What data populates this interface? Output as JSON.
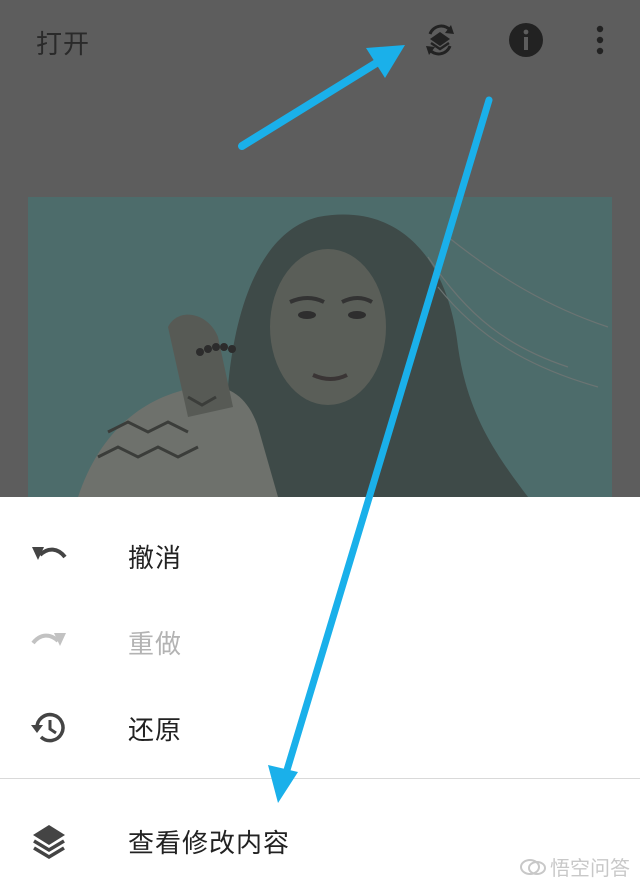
{
  "topbar": {
    "open_label": "打开",
    "icons": [
      "revert-layers-icon",
      "info-icon",
      "more-vert-icon"
    ]
  },
  "sheet": {
    "items": [
      {
        "label": "撤消",
        "icon": "undo-icon",
        "enabled": true
      },
      {
        "label": "重做",
        "icon": "redo-icon",
        "enabled": false
      },
      {
        "label": "还原",
        "icon": "history-icon",
        "enabled": true
      },
      {
        "label": "查看修改内容",
        "icon": "layers-icon",
        "enabled": true
      }
    ]
  },
  "watermark": {
    "text": "悟空问答"
  },
  "colors": {
    "overlay": "#5d5d5d",
    "arrow": "#1ab0ea",
    "disabled": "#b3b3b3"
  }
}
